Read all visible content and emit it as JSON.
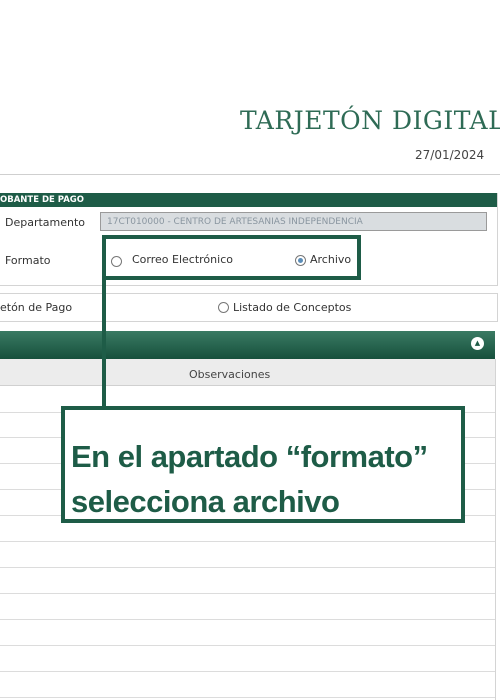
{
  "header": {
    "title": "TARJETÓN DIGITAL",
    "date": "27/01/2024"
  },
  "comprobante_section": {
    "header_label": "OBANTE DE PAGO",
    "departamento_label": "Departamento",
    "departamento_value": "17CT010000 - CENTRO DE ARTESANIAS INDEPENDENCIA",
    "formato_label": "Formato",
    "formato_options": [
      {
        "label": "Correo Electrónico",
        "selected": false
      },
      {
        "label": "Archivo",
        "selected": true
      }
    ]
  },
  "report_section": {
    "tarjeton_label": "etón de Pago",
    "listado_label": "Listado de Conceptos"
  },
  "results_panel": {
    "collapse_icon": "chevron-up-icon",
    "column_observaciones": "Observaciones"
  },
  "callout": {
    "line1": "En el apartado “formato”",
    "line2": "selecciona archivo"
  },
  "colors": {
    "brand_green": "#1e5c47",
    "title_green": "#2e6b55",
    "radio_selected": "#5b8db8"
  }
}
